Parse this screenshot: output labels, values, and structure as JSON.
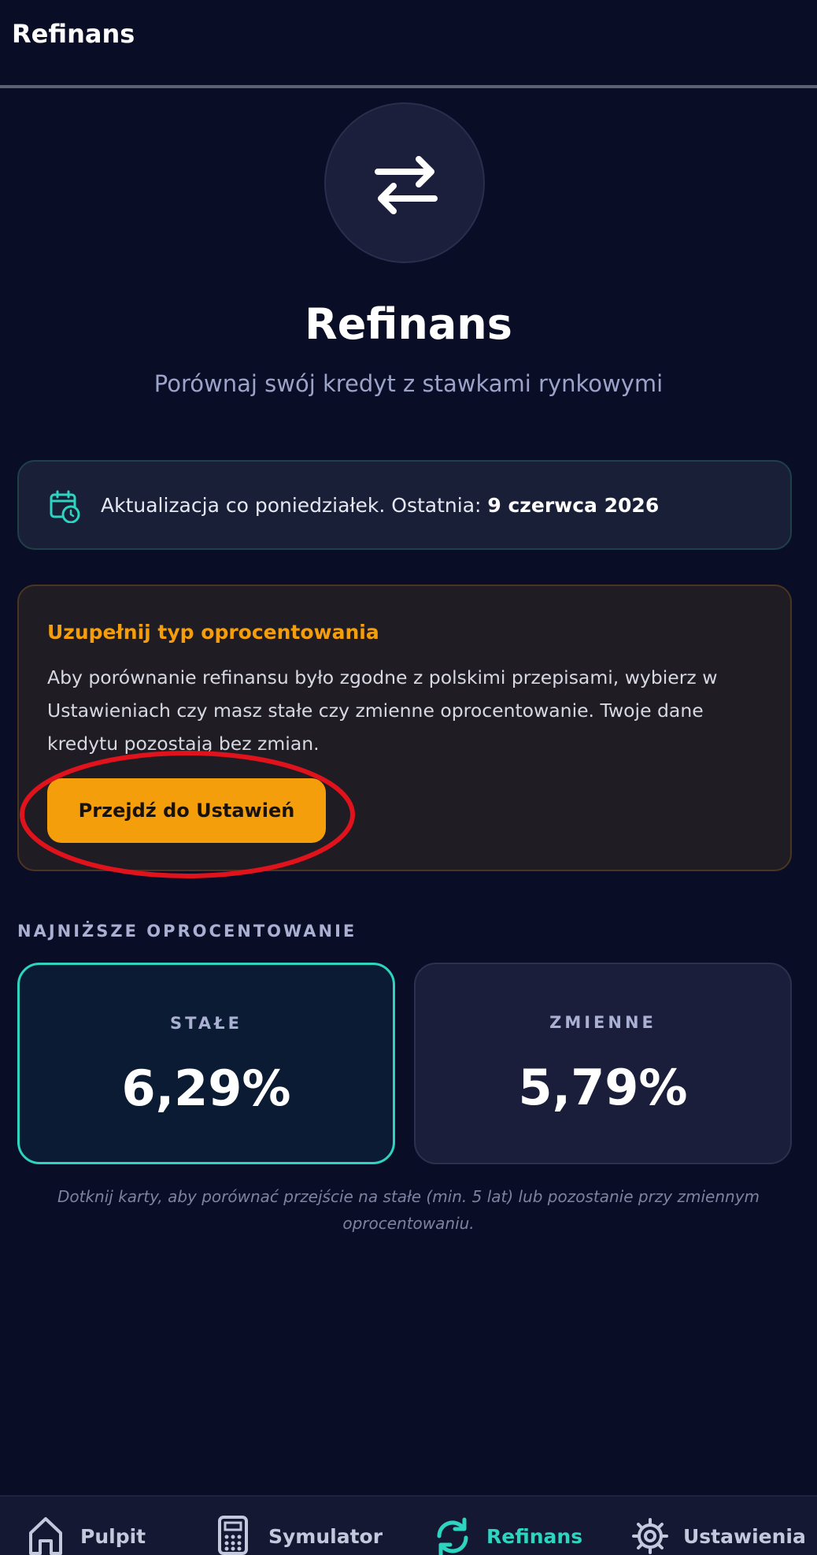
{
  "header": {
    "title": "Refinans"
  },
  "hero": {
    "icon": "arrows-swap-icon",
    "title": "Refinans",
    "subtitle": "Porównaj swój kredyt z stawkami rynkowymi"
  },
  "update": {
    "icon": "calendar-clock-icon",
    "text": "Aktualizacja co poniedziałek. Ostatnia: ",
    "date": "9 czerwca 2026"
  },
  "warning": {
    "title": "Uzupełnij typ oprocentowania",
    "text": "Aby porównanie refinansu było zgodne z polskimi przepisami, wybierz w Ustawieniach czy masz stałe czy zmienne oprocentowanie. Twoje dane kredytu pozostają bez zmian.",
    "button_label": "Przejdź do Ustawień"
  },
  "rates": {
    "section_label": "NAJNIŻSZE OPROCENTOWANIE",
    "fixed": {
      "label": "STAŁE",
      "value": "6,29%"
    },
    "variable": {
      "label": "ZMIENNE",
      "value": "5,79%"
    },
    "hint": "Dotknij karty, aby porównać przejście na stałe (min. 5 lat) lub pozostanie przy zmiennym oprocentowaniu."
  },
  "nav": {
    "items": [
      {
        "label": "Pulpit",
        "icon": "home-icon"
      },
      {
        "label": "Symulator",
        "icon": "calculator-icon"
      },
      {
        "label": "Refinans",
        "icon": "refresh-icon",
        "active": true
      },
      {
        "label": "Ustawienia",
        "icon": "gear-icon"
      }
    ]
  },
  "colors": {
    "background": "#0a0d26",
    "accent": "#2dd4bf",
    "warning": "#f59e0b",
    "annotation": "#e0121b"
  }
}
